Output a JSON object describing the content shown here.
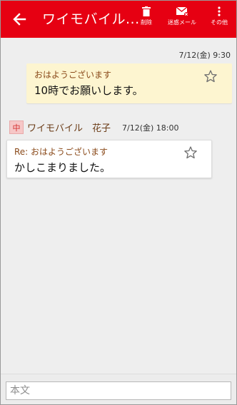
{
  "appbar": {
    "title": "ワイモバイル...",
    "back_icon": "arrow-left-icon",
    "actions": [
      {
        "icon": "trash-icon",
        "label": "削除"
      },
      {
        "icon": "mail-icon",
        "label": "迷惑メール"
      },
      {
        "icon": "more-vertical-icon",
        "label": "その他"
      }
    ],
    "color": "#e60012"
  },
  "messages": {
    "sent": {
      "timestamp": "7/12(金) 9:30",
      "subject": "おはようございます",
      "body": "10時でお願いします。",
      "starred": false,
      "bubble_color": "#fdf5d0"
    },
    "received": {
      "sim_badge": "中",
      "sender": "ワイモバイル　花子",
      "timestamp": "7/12(金) 18:00",
      "subject": "Re: おはようございます",
      "body": "かしこまりました。",
      "starred": false
    }
  },
  "composer": {
    "placeholder": "本文",
    "value": ""
  }
}
